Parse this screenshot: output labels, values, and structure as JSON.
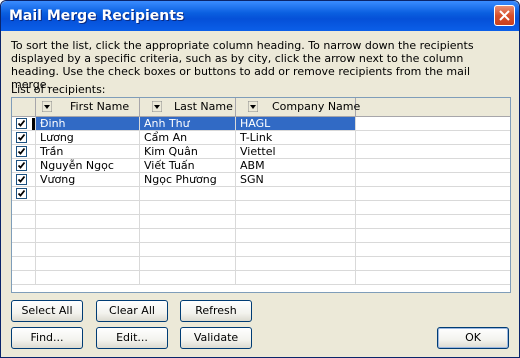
{
  "window": {
    "title": "Mail Merge Recipients"
  },
  "description": "To sort the list, click the appropriate column heading.  To narrow down the recipients displayed by a specific criteria, such as by city, click the arrow next to the column heading.  Use the check boxes or buttons to add or remove recipients from the mail merge.",
  "list_label": "List of recipients:",
  "columns": [
    "First Name",
    "Last Name",
    "Company Name"
  ],
  "rows": [
    {
      "checked": true,
      "first": "Đinh",
      "last": "Anh Thư",
      "company": "HAGL",
      "selected": true
    },
    {
      "checked": true,
      "first": "Lương",
      "last": "Cẩm An",
      "company": "T-Link",
      "selected": false
    },
    {
      "checked": true,
      "first": "Trần",
      "last": "Kim Quân",
      "company": "Viettel",
      "selected": false
    },
    {
      "checked": true,
      "first": "Nguyễn Ngọc",
      "last": "Viết Tuấn",
      "company": "ABM",
      "selected": false
    },
    {
      "checked": true,
      "first": "Vương",
      "last": "Ngọc Phương",
      "company": "SGN",
      "selected": false
    },
    {
      "checked": true,
      "first": "",
      "last": "",
      "company": "",
      "selected": false
    }
  ],
  "buttons": {
    "select_all": "Select All",
    "clear_all": "Clear All",
    "refresh": "Refresh",
    "find": "Find...",
    "edit": "Edit...",
    "validate": "Validate",
    "ok": "OK"
  },
  "colors": {
    "title_bar": "#0a5fe0",
    "selection": "#316ac5",
    "close_button": "#d8502c"
  },
  "icons": {
    "close": "close-icon",
    "dropdown": "chevron-down-icon",
    "checkbox": "check-icon"
  }
}
